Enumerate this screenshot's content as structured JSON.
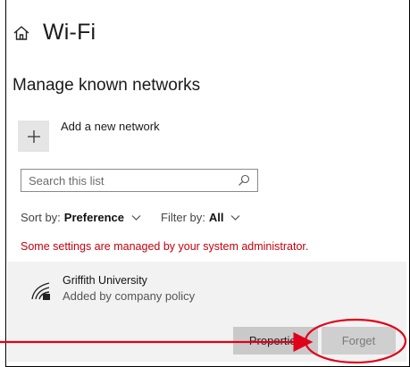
{
  "header": {
    "title": "Wi-Fi",
    "home_icon": "home-icon"
  },
  "section": {
    "title": "Manage known networks"
  },
  "add_network": {
    "label": "Add a new network",
    "icon": "plus-icon"
  },
  "search": {
    "placeholder": "Search this list",
    "icon": "search-icon"
  },
  "filters": {
    "sort_prefix": "Sort by:",
    "sort_value": "Preference",
    "filter_prefix": "Filter by:",
    "filter_value": "All"
  },
  "admin_notice": "Some settings are managed by your system administrator.",
  "network": {
    "name": "Griffith University",
    "subtitle": "Added by company policy",
    "icon": "wifi-secured-icon",
    "properties_label": "Properties",
    "forget_label": "Forget"
  },
  "colors": {
    "notice": "#c4000e",
    "annotation": "#e0001a",
    "card_bg": "#f2f2f2"
  }
}
